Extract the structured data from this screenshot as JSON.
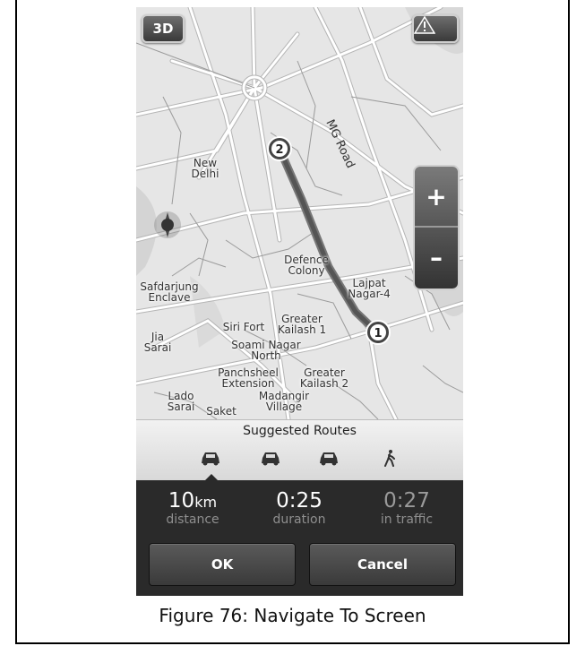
{
  "map": {
    "btn_3d": "3D",
    "warning_icon": "warning-icon",
    "compass_icon": "compass-icon",
    "zoom_in": "+",
    "zoom_out": "–",
    "road_label": "MG Road",
    "waypoints": [
      "1",
      "2"
    ],
    "places": [
      "New Delhi",
      "Defence Colony",
      "Lajpat Nagar-4",
      "Safdarjung Enclave",
      "Siri Fort",
      "Greater Kailash 1",
      "Jia Sarai",
      "Soami Nagar North",
      "Panchsheel Extension",
      "Greater Kailash 2",
      "Lado Sarai",
      "Saket",
      "Madangir Village"
    ]
  },
  "routes": {
    "title": "Suggested Routes",
    "modes": [
      "car-icon",
      "car-icon",
      "car-icon",
      "walk-icon"
    ]
  },
  "stats": {
    "distance_value": "10",
    "distance_unit": "km",
    "distance_label": "distance",
    "duration_value": "0:25",
    "duration_label": "duration",
    "traffic_value": "0:27",
    "traffic_label": "in traffic"
  },
  "actions": {
    "ok": "OK",
    "cancel": "Cancel"
  },
  "caption": "Figure 76: Navigate To Screen"
}
